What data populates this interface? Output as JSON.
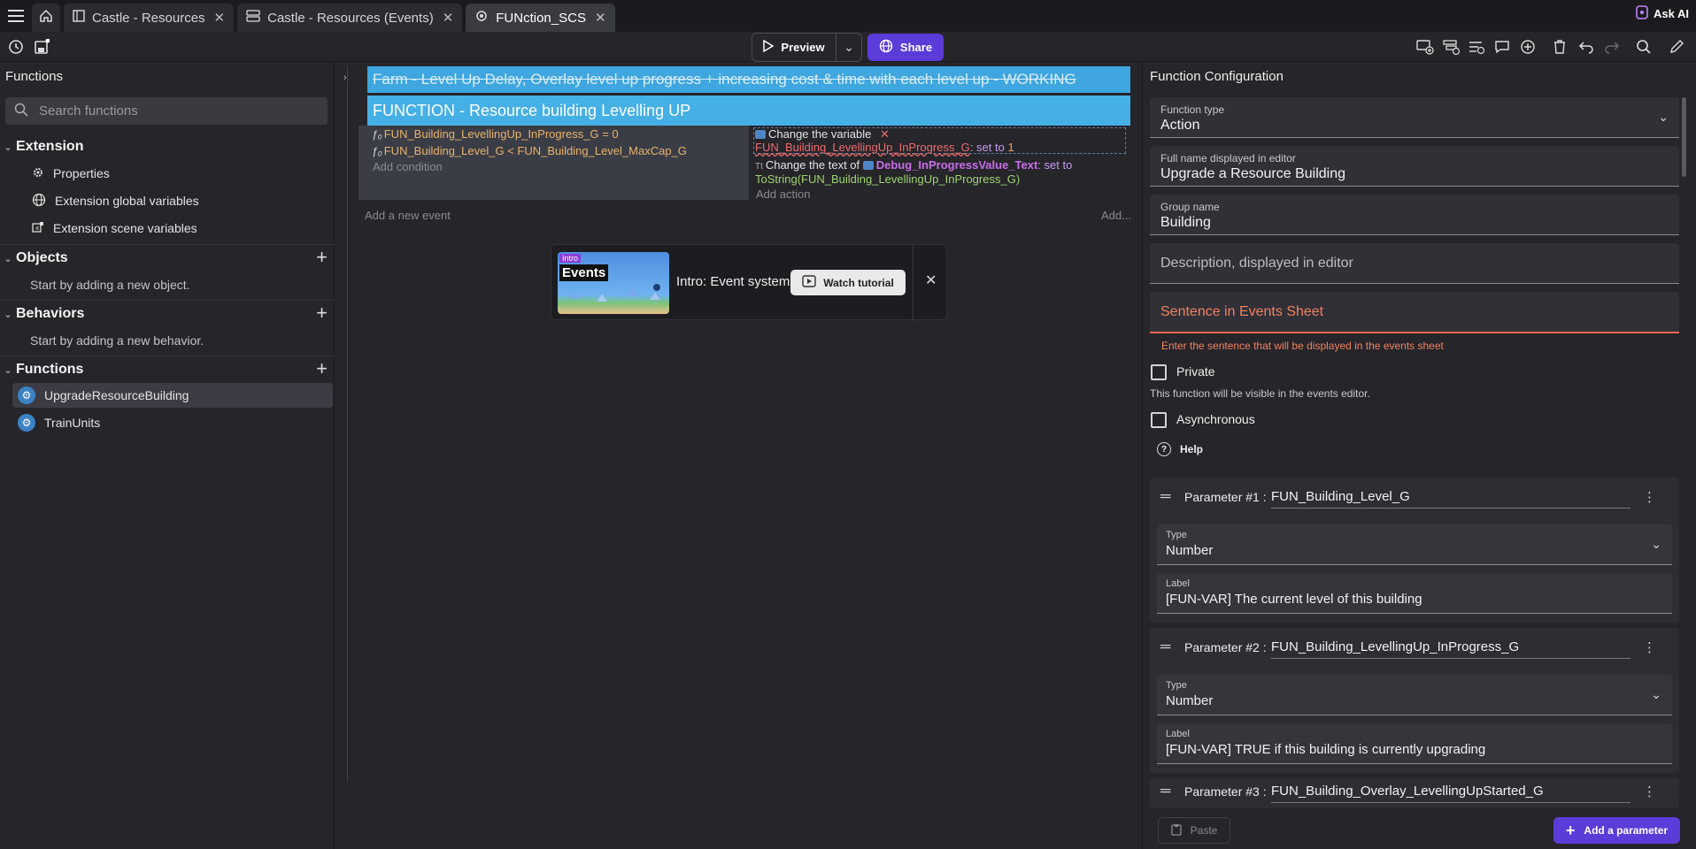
{
  "tabs": [
    {
      "label": "Castle - Resources"
    },
    {
      "label": "Castle - Resources (Events)"
    },
    {
      "label": "FUNction_SCS"
    }
  ],
  "ask_ai": "Ask AI",
  "toolbar": {
    "preview_label": "Preview",
    "share_label": "Share"
  },
  "left": {
    "title": "Functions",
    "search_placeholder": "Search functions",
    "extension": {
      "title": "Extension",
      "items": [
        "Properties",
        "Extension global variables",
        "Extension scene variables"
      ]
    },
    "objects": {
      "title": "Objects",
      "hint": "Start by adding a new object."
    },
    "behaviors": {
      "title": "Behaviors",
      "hint": "Start by adding a new behavior."
    },
    "functions": {
      "title": "Functions",
      "items": [
        "UpgradeResourceBuilding",
        "TrainUnits"
      ]
    }
  },
  "events": {
    "comment": "Farm - Level Up Delay, Overlay level up progress + increasing cost & time with each level up - WORKING",
    "group": "FUNCTION - Resource building Levelling UP",
    "conditions": [
      "FUN_Building_LevellingUp_InProgress_G = 0",
      "FUN_Building_Level_G < FUN_Building_Level_MaxCap_G"
    ],
    "add_condition": "Add condition",
    "action1_title": "Change the variable",
    "action1_var": "FUN_Building_LevellingUp_InProgress_G",
    "action1_op": ": set to ",
    "action1_val": "1",
    "action2_prefix": "Change the text of ",
    "action2_obj": "Debug_InProgressValue_Text",
    "action2_op": ": set to",
    "action2_expr": "ToString(FUN_Building_LevellingUp_InProgress_G)",
    "add_action": "Add action",
    "add_event": "Add a new event",
    "add_more": "Add..."
  },
  "tutorial": {
    "badge": "Intro",
    "thumb_label": "Events",
    "title": "Intro: Event system",
    "button": "Watch tutorial"
  },
  "config": {
    "title": "Function Configuration",
    "function_type_label": "Function type",
    "function_type_value": "Action",
    "fullname_label": "Full name displayed in editor",
    "fullname_value": "Upgrade a Resource Building",
    "group_label": "Group name",
    "group_value": "Building",
    "description_placeholder": "Description, displayed in editor",
    "sentence_placeholder": "Sentence in Events Sheet",
    "sentence_error": "Enter the sentence that will be displayed in the events sheet",
    "private_label": "Private",
    "private_hint": "This function will be visible in the events editor.",
    "async_label": "Asynchronous",
    "help_label": "Help",
    "params": [
      {
        "name": "Parameter #1 :",
        "value": "FUN_Building_Level_G",
        "type_label": "Type",
        "type": "Number",
        "label_label": "Label",
        "label": "[FUN-VAR] The current level of this building"
      },
      {
        "name": "Parameter #2 :",
        "value": "FUN_Building_LevellingUp_InProgress_G",
        "type_label": "Type",
        "type": "Number",
        "label_label": "Label",
        "label": "[FUN-VAR] TRUE if this building is currently upgrading"
      },
      {
        "name": "Parameter #3 :",
        "value": "FUN_Building_Overlay_LevellingUpStarted_G"
      }
    ],
    "paste_label": "Paste",
    "add_param_label": "Add a parameter"
  }
}
